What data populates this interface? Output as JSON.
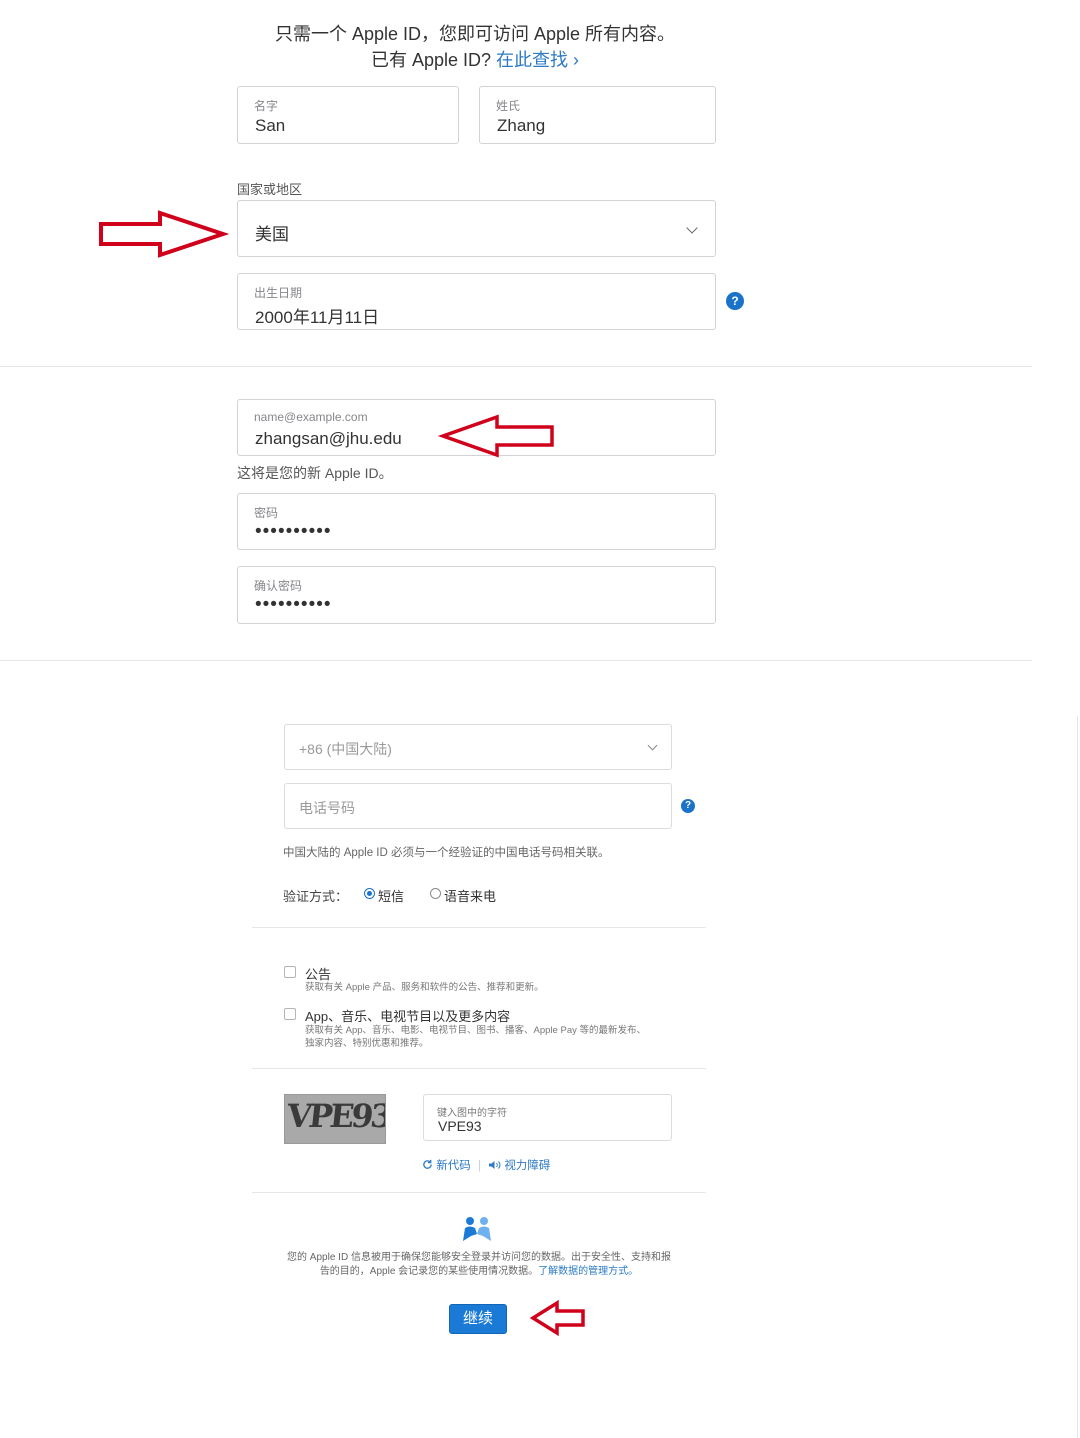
{
  "intro": {
    "line1": "只需一个 Apple ID，您即可访问 Apple 所有内容。",
    "line2_prefix": "已有 Apple ID?",
    "line2_link": "在此查找 ›"
  },
  "name": {
    "first_label": "名字",
    "first_value": "San",
    "last_label": "姓氏",
    "last_value": "Zhang"
  },
  "country": {
    "label": "国家或地区",
    "value": "美国"
  },
  "birthday": {
    "label": "出生日期",
    "value": "2000年11月11日",
    "help": "?"
  },
  "email": {
    "label": "name@example.com",
    "value": "zhangsan@jhu.edu",
    "helper": "这将是您的新 Apple ID。"
  },
  "password": {
    "label": "密码",
    "value": "••••••••••"
  },
  "confirm": {
    "label": "确认密码",
    "value": "••••••••••"
  },
  "phone": {
    "country_code": "+86 (中国大陆)",
    "placeholder": "电话号码",
    "help": "?",
    "notice": "中国大陆的 Apple ID 必须与一个经验证的中国电话号码相关联。",
    "verify_label": "验证方式：",
    "sms": "短信",
    "voice": "语音来电"
  },
  "options": {
    "announce_title": "公告",
    "announce_desc": "获取有关 Apple 产品、服务和软件的公告、推荐和更新。",
    "apps_title": "App、音乐、电视节目以及更多内容",
    "apps_desc_1": "获取有关 App、音乐、电影、电视节目、图书、播客、Apple Pay 等的最新发布、",
    "apps_desc_2": "独家内容、特别优惠和推荐。"
  },
  "captcha": {
    "image_text": "VPE93",
    "label": "键入图中的字符",
    "value": "VPE93",
    "new_code": "新代码",
    "vision": "视力障碍"
  },
  "privacy": {
    "line1": "您的 Apple ID 信息被用于确保您能够安全登录并访问您的数据。出于安全性、支持和报",
    "line2_prefix": "告的目的，Apple 会记录您的某些使用情况数据。",
    "line2_link": "了解数据的管理方式。"
  },
  "continue_label": "继续",
  "colors": {
    "accent": "#1b7ad6",
    "link": "#2d7ac5",
    "annotation_arrow": "#d0021b"
  }
}
